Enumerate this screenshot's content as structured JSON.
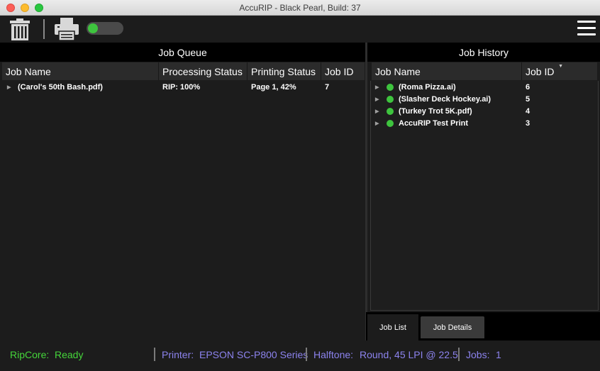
{
  "window": {
    "title": "AccuRIP - Black Pearl, Build: 37"
  },
  "toolbar": {
    "toggle_on": true,
    "accent": "#3ec43e"
  },
  "queue": {
    "title": "Job Queue",
    "columns": [
      "Job Name",
      "Processing Status",
      "Printing Status",
      "Job ID"
    ],
    "rows": [
      {
        "name": "(Carol's 50th Bash.pdf)",
        "processing": "RIP: 100%",
        "printing": "Page 1,  42%",
        "id": "7"
      }
    ]
  },
  "history": {
    "title": "Job History",
    "columns": [
      "Job Name",
      "Job ID"
    ],
    "rows": [
      {
        "name": "(Roma Pizza.ai)",
        "id": "6",
        "status_color": "#3ec43e"
      },
      {
        "name": "(Slasher Deck Hockey.ai)",
        "id": "5",
        "status_color": "#3ec43e"
      },
      {
        "name": "(Turkey Trot 5K.pdf)",
        "id": "4",
        "status_color": "#3ec43e"
      },
      {
        "name": "AccuRIP Test Print",
        "id": "3",
        "status_color": "#3ec43e"
      }
    ]
  },
  "tabs": {
    "job_list": "Job List",
    "job_details": "Job Details"
  },
  "status": {
    "ripcore_label": "RipCore:",
    "ripcore_value": "Ready",
    "printer_label": "Printer:",
    "printer_value": "EPSON SC-P800 Series",
    "halftone_label": "Halftone:",
    "halftone_value": "Round, 45 LPI @ 22.5",
    "jobs_label": "Jobs:",
    "jobs_value": "1"
  }
}
